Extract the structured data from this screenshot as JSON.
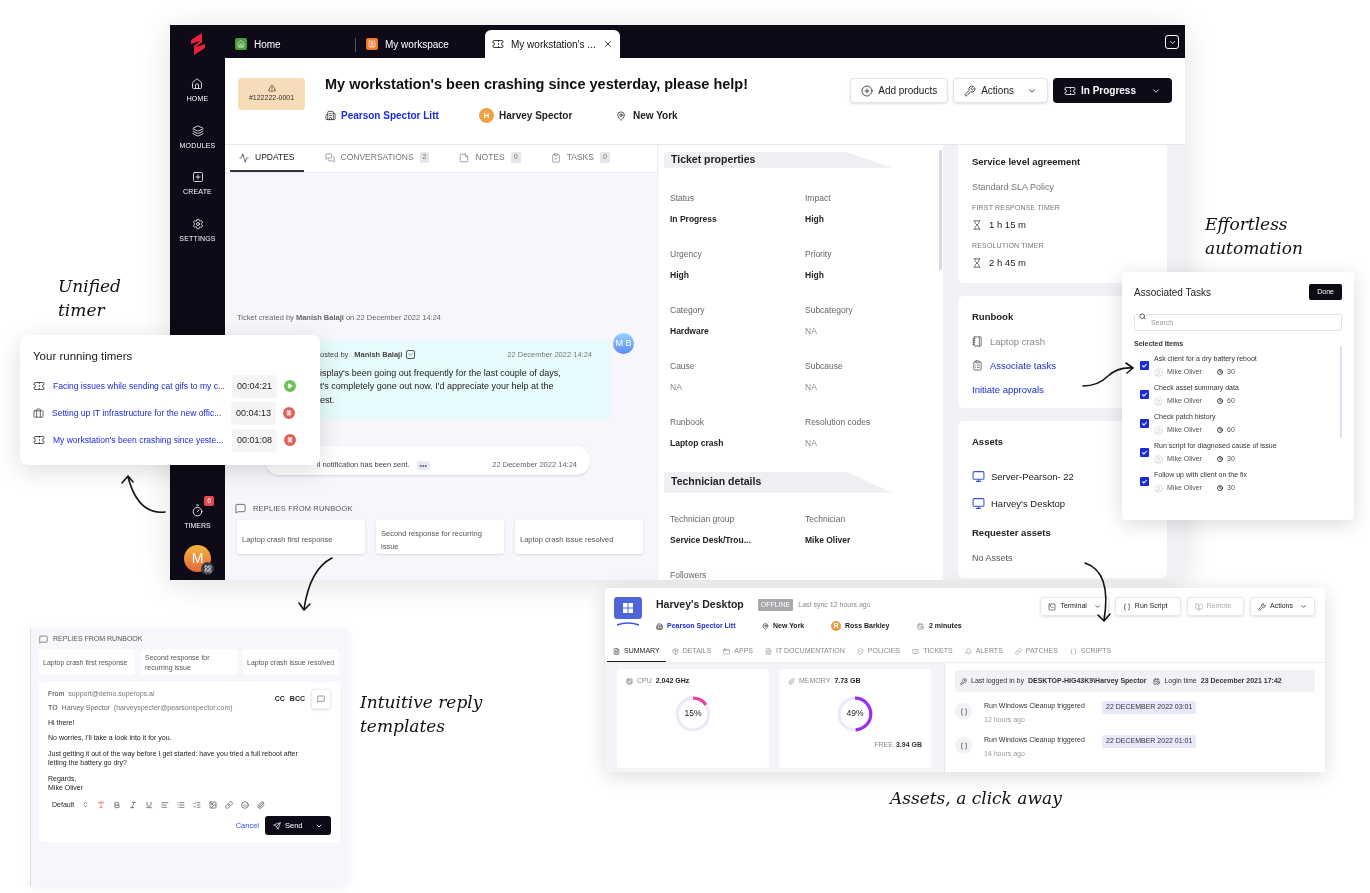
{
  "main_window": {
    "sidebar": {
      "items": [
        {
          "label": "HOME",
          "kind": "home"
        },
        {
          "label": "MODULES",
          "kind": "modules"
        },
        {
          "label": "CREATE",
          "kind": "create"
        },
        {
          "label": "SETTINGS",
          "kind": "settings"
        }
      ],
      "timers": {
        "label": "TIMERS",
        "badge": "6"
      },
      "avatar": "M"
    },
    "tabs": [
      {
        "label": "Home",
        "kind": "home",
        "selected": false
      },
      {
        "label": "My workspace",
        "kind": "workspace",
        "selected": false
      },
      {
        "label": "My workstation's ...",
        "kind": "ticket",
        "selected": true
      }
    ],
    "ticket": {
      "id": "#122222-0001",
      "title": "My workstation's been crashing since yesterday, please help!",
      "company": "Pearson Spector Litt",
      "requester_initial": "H",
      "requester": "Harvey Spector",
      "location": "New York"
    },
    "buttons": [
      {
        "label": "Add products",
        "kind": "add"
      },
      {
        "label": "Actions",
        "kind": "actions"
      },
      {
        "label": "In Progress",
        "kind": "status"
      }
    ],
    "feed_tabs": [
      {
        "label": "UPDATES",
        "selected": true
      },
      {
        "label": "CONVERSATIONS",
        "count": "2",
        "selected": false
      },
      {
        "label": "NOTES",
        "count": "0",
        "selected": false
      },
      {
        "label": "TASKS",
        "count": "0",
        "selected": false
      }
    ],
    "feed": {
      "created": "Ticket created by **Manish Balaji** on 22 December 2022 14:24",
      "message": {
        "avatar": "M B",
        "author_prefix": "osted by",
        "author": "Manish Balaji",
        "time": "22 December 2022 14:24",
        "lines": [
          "isplay's been going out frequently for the last couple of days,",
          "t's completely gone out now. I'd appreciate your help at the",
          "est."
        ]
      },
      "notification": {
        "text": "il notification has been sent.",
        "more": "•••",
        "time": "22 December 2022 14:24"
      },
      "replies": {
        "title": "REPLIES FROM RUNBOOK",
        "items": [
          "Laptop crash first response",
          "Second response for recurring issue",
          "Laptop crash issue resolved"
        ]
      }
    },
    "ticket_properties": {
      "title": "Ticket properties",
      "fields": [
        {
          "label": "Status",
          "value": "In Progress",
          "muted": false
        },
        {
          "label": "Impact",
          "value": "High",
          "muted": false
        },
        {
          "label": "Urgency",
          "value": "High",
          "muted": false
        },
        {
          "label": "Priority",
          "value": "High",
          "muted": false
        },
        {
          "label": "Category",
          "value": "Hardware",
          "muted": false
        },
        {
          "label": "Subcategory",
          "value": "NA",
          "muted": true
        },
        {
          "label": "Cause",
          "value": "NA",
          "muted": true
        },
        {
          "label": "Subcause",
          "value": "NA",
          "muted": true
        },
        {
          "label": "Runbook",
          "value": "Laptop crash",
          "muted": false
        },
        {
          "label": "Resolution codes",
          "value": "NA",
          "muted": true
        }
      ]
    },
    "technician_details": {
      "title": "Technician details",
      "fields": [
        {
          "label": "Technician group",
          "value": "Service Desk/Trou...",
          "muted": false
        },
        {
          "label": "Technician",
          "value": "Mike Oliver",
          "muted": false
        },
        {
          "label": "Followers"
        }
      ]
    },
    "sla": {
      "title": "Service level agreement",
      "policy": "Standard SLA Policy",
      "timers": [
        {
          "label": "FIRST RESPONSE TIMER",
          "value": "1 h 15 m"
        },
        {
          "label": "RESOLUTION TIMER",
          "value": "2 h 45 m"
        }
      ]
    },
    "runbook": {
      "title": "Runbook",
      "items": [
        {
          "label": "Laptop crash",
          "kind": "book"
        },
        {
          "label": "Associate tasks",
          "kind": "task"
        },
        {
          "label": "Initiate approvals",
          "kind": "link"
        }
      ]
    },
    "assets": {
      "title": "Assets",
      "items": [
        "Server-Pearson- 22",
        "Harvey's Desktop"
      ],
      "requester_title": "Requester assets",
      "requester_value": "No Assets"
    }
  },
  "timers_card": {
    "title": "Your running timers",
    "items": [
      {
        "label": "Facing issues while sending cat gifs to my c...",
        "time": "00:04:21",
        "kind": "ticket",
        "running": false
      },
      {
        "label": "Setting up IT infrastructure for the new offic...",
        "time": "00:04:13",
        "kind": "project",
        "running": true
      },
      {
        "label": "My workstation's been crashing since yeste...",
        "time": "00:01:08",
        "kind": "ticket",
        "running": true
      }
    ]
  },
  "tasks_card": {
    "title": "Associated Tasks",
    "done": "Done",
    "search_placeholder": "Search",
    "section": "Selected Items",
    "items": [
      {
        "label": "Ask client for a dry battery reboot",
        "owner": "Mike Oliver",
        "minutes": "30",
        "checked": true
      },
      {
        "label": "Check asset summary data",
        "owner": "Mike Oliver",
        "minutes": "60",
        "checked": true
      },
      {
        "label": "Check patch history",
        "owner": "Mike Oliver",
        "minutes": "60",
        "checked": true
      },
      {
        "label": "Run script for diagnosed cause of issue",
        "owner": "Mike Oliver",
        "minutes": "30",
        "checked": true
      },
      {
        "label": "Follow up with client on the fix",
        "owner": "Mike Oliver",
        "minutes": "30",
        "checked": true
      }
    ]
  },
  "reply_panel": {
    "title": "REPLIES FROM RUNBOOK",
    "items": [
      "Laptop crash first response",
      "Second response for recurring issue",
      "Laptop crash issue resolved"
    ],
    "from_label": "From",
    "from": "support@demo.superops.ai",
    "to_label": "TO",
    "to": "Harvey Spector",
    "to_email": "(harveyspecter@pearsonspector.com)",
    "cc": "CC",
    "bcc": "BCC",
    "body": [
      "Hi there!",
      "No worries, I'll take a look into it for you.",
      "Just getting it out of the way before I get started: have you tried a full reboot after letting the battery go dry?",
      "Regards,\n Mike Oliver"
    ],
    "font_select": "Default",
    "cancel": "Cancel",
    "send": "Send"
  },
  "asset_panel": {
    "name": "Harvey's Desktop",
    "status": "OFFLINE",
    "sync": "Last sync 12 hours ago",
    "company": "Pearson Spector Litt",
    "location": "New York",
    "user_initial": "R",
    "user": "Ross Barkley",
    "uptime": "2 minutes",
    "buttons": [
      {
        "label": "Terminal",
        "kind": "terminal",
        "disabled": false
      },
      {
        "label": "Run Script",
        "kind": "script",
        "disabled": false
      },
      {
        "label": "Remote",
        "kind": "remote",
        "disabled": true
      },
      {
        "label": "Actions",
        "kind": "actions",
        "disabled": false
      }
    ],
    "tabs": [
      {
        "label": "SUMMARY",
        "kind": "summary",
        "selected": true
      },
      {
        "label": "DETAILS",
        "kind": "details",
        "selected": false
      },
      {
        "label": "APPS",
        "kind": "apps",
        "selected": false
      },
      {
        "label": "IT DOCUMENTATION",
        "kind": "docs",
        "selected": false
      },
      {
        "label": "POLICIES",
        "kind": "policies",
        "selected": false
      },
      {
        "label": "TICKETS",
        "kind": "tickets",
        "selected": false
      },
      {
        "label": "ALERTS",
        "kind": "alerts",
        "selected": false
      },
      {
        "label": "PATCHES",
        "kind": "patches",
        "selected": false
      },
      {
        "label": "SCRIPTS",
        "kind": "scripts",
        "selected": false
      }
    ],
    "gauges": [
      {
        "label": "CPU",
        "value": "2.042 GHz",
        "reading": "15%",
        "level": 0.15,
        "color": "#e940a8",
        "kind": "cpu"
      },
      {
        "label": "MEMORY",
        "value": "7.73 GB",
        "reading": "49%",
        "level": 0.49,
        "color": "#9b30e8",
        "kind": "memory",
        "free_label": "FREE",
        "free": "3.94 GB"
      }
    ],
    "login": {
      "label": "Last logged in by",
      "user": "DESKTOP-HIG43K9\\Harvey Spector",
      "time_label": "Login time",
      "time": "23 December 2021 17:42"
    },
    "activity": [
      {
        "text": "Run Windows Cleanup triggered",
        "ago": "12 hours ago",
        "date": "22 DECEMBER 2022 03:01"
      },
      {
        "text": "Run Windows Cleanup triggered",
        "ago": "14 hours ago",
        "date": "22 DECEMBER 2022 01:01"
      }
    ]
  },
  "captions": {
    "timer": "Unified timer",
    "automation": "Effortless automation",
    "reply": "Intuitive reply templates",
    "assets": "Assets, a click away"
  }
}
